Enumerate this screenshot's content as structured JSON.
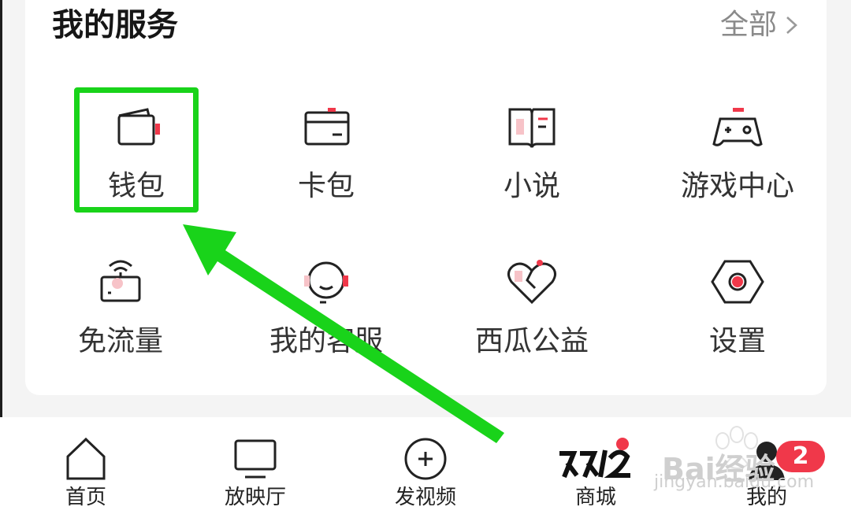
{
  "section": {
    "title": "我的服务",
    "view_all": "全部"
  },
  "services": [
    {
      "label": "钱包",
      "icon": "wallet-icon"
    },
    {
      "label": "卡包",
      "icon": "card-wallet-icon"
    },
    {
      "label": "小说",
      "icon": "book-icon"
    },
    {
      "label": "游戏中心",
      "icon": "gamepad-icon"
    },
    {
      "label": "免流量",
      "icon": "router-wifi-icon"
    },
    {
      "label": "我的客服",
      "icon": "headset-icon"
    },
    {
      "label": "西瓜公益",
      "icon": "heart-icon"
    },
    {
      "label": "设置",
      "icon": "hex-nut-settings-icon"
    }
  ],
  "nav": [
    {
      "label": "首页",
      "icon": "home-icon"
    },
    {
      "label": "放映厅",
      "icon": "tv-icon"
    },
    {
      "label": "发视频",
      "icon": "plus-circle-icon"
    },
    {
      "label": "商城",
      "icon": "double12-logo"
    },
    {
      "label": "我的",
      "icon": "profile-icon",
      "badge": "2"
    }
  ],
  "watermark": {
    "text": "Bai经验",
    "sub": "jingyan.baidu.com"
  },
  "colors": {
    "accent": "#f0384a",
    "highlight": "#19d31a",
    "text": "#333333"
  }
}
